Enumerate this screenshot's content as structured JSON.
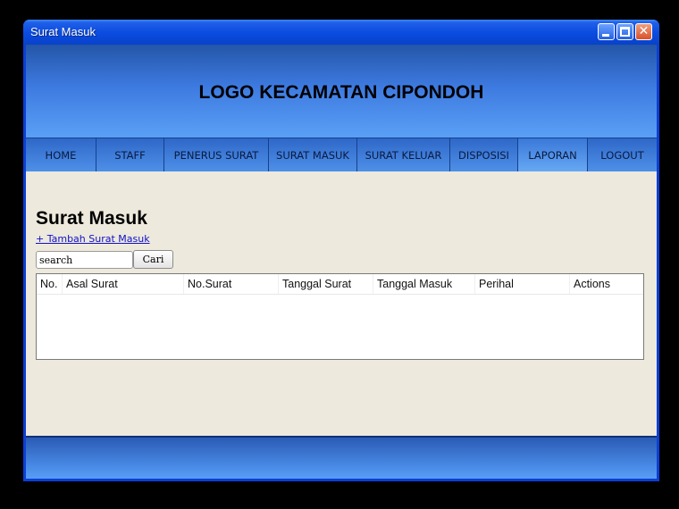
{
  "window": {
    "title": "Surat Masuk"
  },
  "header": {
    "logo_text": "LOGO KECAMATAN CIPONDOH"
  },
  "nav": {
    "items": [
      {
        "label": "HOME"
      },
      {
        "label": "STAFF"
      },
      {
        "label": "PENERUS SURAT"
      },
      {
        "label": "SURAT MASUK"
      },
      {
        "label": "SURAT KELUAR"
      },
      {
        "label": "DISPOSISI"
      },
      {
        "label": "LAPORAN"
      },
      {
        "label": "LOGOUT"
      }
    ]
  },
  "main": {
    "title": "Surat Masuk",
    "add_link": "+ Tambah Surat Masuk",
    "search": {
      "value": "search",
      "button_label": "Cari"
    },
    "table": {
      "columns": [
        "No.",
        "Asal Surat",
        "No.Surat",
        "Tanggal Surat",
        "Tanggal Masuk",
        "Perihal",
        "Actions"
      ],
      "rows": []
    }
  }
}
